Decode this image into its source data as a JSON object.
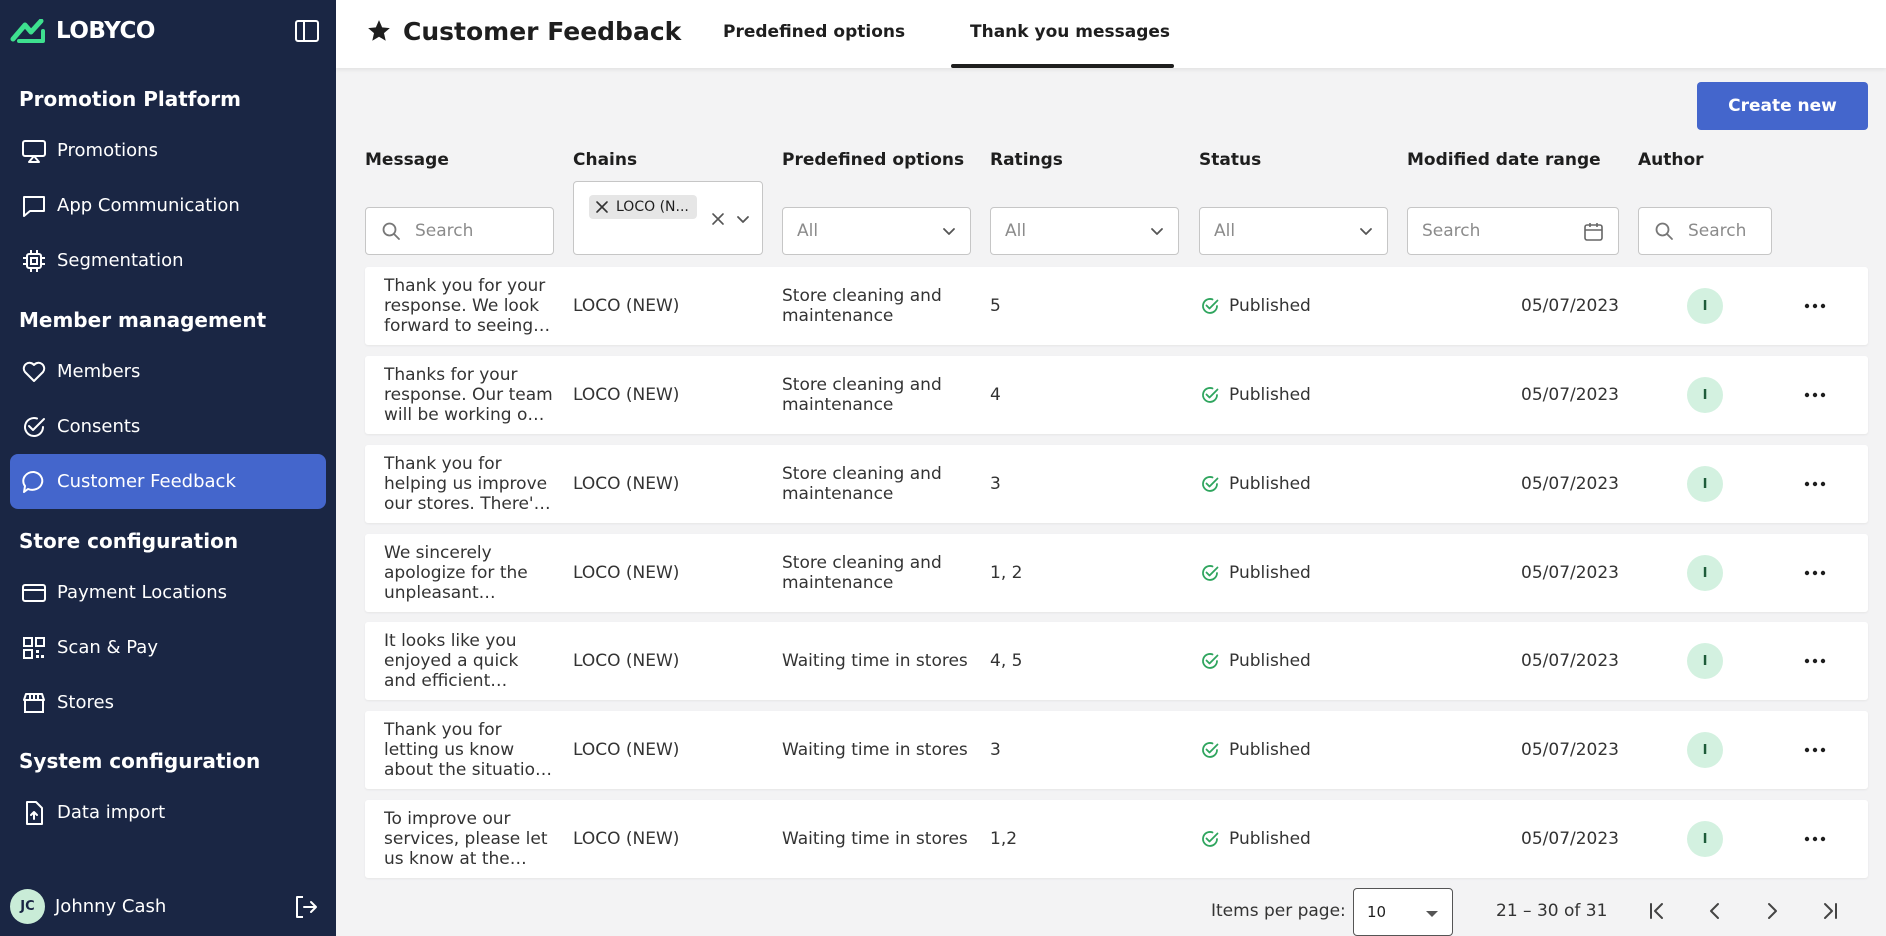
{
  "app": {
    "logo_text": "LOBYCO"
  },
  "sidebar": {
    "sections": [
      {
        "title": "Promotion Platform"
      },
      {
        "title": "Member management"
      },
      {
        "title": "Store configuration"
      },
      {
        "title": "System configuration"
      }
    ],
    "items": [
      {
        "label": "Promotions",
        "icon": "promotions-icon"
      },
      {
        "label": "App Communication",
        "icon": "chat-icon"
      },
      {
        "label": "Segmentation",
        "icon": "chip-icon"
      },
      {
        "label": "Members",
        "icon": "heart-icon"
      },
      {
        "label": "Consents",
        "icon": "check-circle-icon"
      },
      {
        "label": "Customer Feedback",
        "icon": "feedback-icon",
        "active": true
      },
      {
        "label": "Payment Locations",
        "icon": "credit-card-icon"
      },
      {
        "label": "Scan & Pay",
        "icon": "qr-code-icon"
      },
      {
        "label": "Stores",
        "icon": "store-icon"
      },
      {
        "label": "Data import",
        "icon": "file-upload-icon"
      }
    ],
    "user": {
      "initials": "JC",
      "name": "Johnny Cash"
    }
  },
  "header": {
    "title": "Customer Feedback",
    "tabs": [
      {
        "label": "Predefined options"
      },
      {
        "label": "Thank you messages",
        "active": true
      }
    ]
  },
  "toolbar": {
    "create_label": "Create new"
  },
  "columns": {
    "message": "Message",
    "chains": "Chains",
    "predefined": "Predefined options",
    "ratings": "Ratings",
    "status": "Status",
    "modified": "Modified date range",
    "author": "Author"
  },
  "filters": {
    "message_placeholder": "Search",
    "chains_chip": "LOCO (N...",
    "predefined_value": "All",
    "ratings_value": "All",
    "status_value": "All",
    "modified_placeholder": "Search",
    "author_placeholder": "Search"
  },
  "rows": [
    {
      "message": "Thank you for your response. We look forward to seeing you again soon.",
      "chain": "LOCO (NEW)",
      "option": "Store cleaning and maintenance",
      "ratings": "5",
      "status": "Published",
      "date": "05/07/2023",
      "author": "I"
    },
    {
      "message": "Thanks for your response. Our team will be working on it.",
      "chain": "LOCO (NEW)",
      "option": "Store cleaning and maintenance",
      "ratings": "4",
      "status": "Published",
      "date": "05/07/2023",
      "author": "I"
    },
    {
      "message": "Thank you for helping us improve our stores. There's more to come.",
      "chain": "LOCO (NEW)",
      "option": "Store cleaning and maintenance",
      "ratings": "3",
      "status": "Published",
      "date": "05/07/2023",
      "author": "I"
    },
    {
      "message": "We sincerely apologize for the unpleasant experience.",
      "chain": "LOCO (NEW)",
      "option": "Store cleaning and maintenance",
      "ratings": "1, 2",
      "status": "Published",
      "date": "05/07/2023",
      "author": "I"
    },
    {
      "message": "It looks like you enjoyed a quick and efficient shopping trip.",
      "chain": "LOCO (NEW)",
      "option": "Waiting time in stores",
      "ratings": "4, 5",
      "status": "Published",
      "date": "05/07/2023",
      "author": "I"
    },
    {
      "message": "Thank you for letting us know about the situation in our store.",
      "chain": "LOCO (NEW)",
      "option": "Waiting time in stores",
      "ratings": "3",
      "status": "Published",
      "date": "05/07/2023",
      "author": "I"
    },
    {
      "message": "To improve our services, please let us know at the checkout.",
      "chain": "LOCO (NEW)",
      "option": "Waiting time in stores",
      "ratings": "1,2",
      "status": "Published",
      "date": "05/07/2023",
      "author": "I"
    }
  ],
  "pagination": {
    "label": "Items per page:",
    "page_size": "10",
    "range": "21 – 30 of 31"
  },
  "colors": {
    "sidebar_bg": "#1a2644",
    "accent": "#4466cc",
    "published": "#2fa55e"
  }
}
